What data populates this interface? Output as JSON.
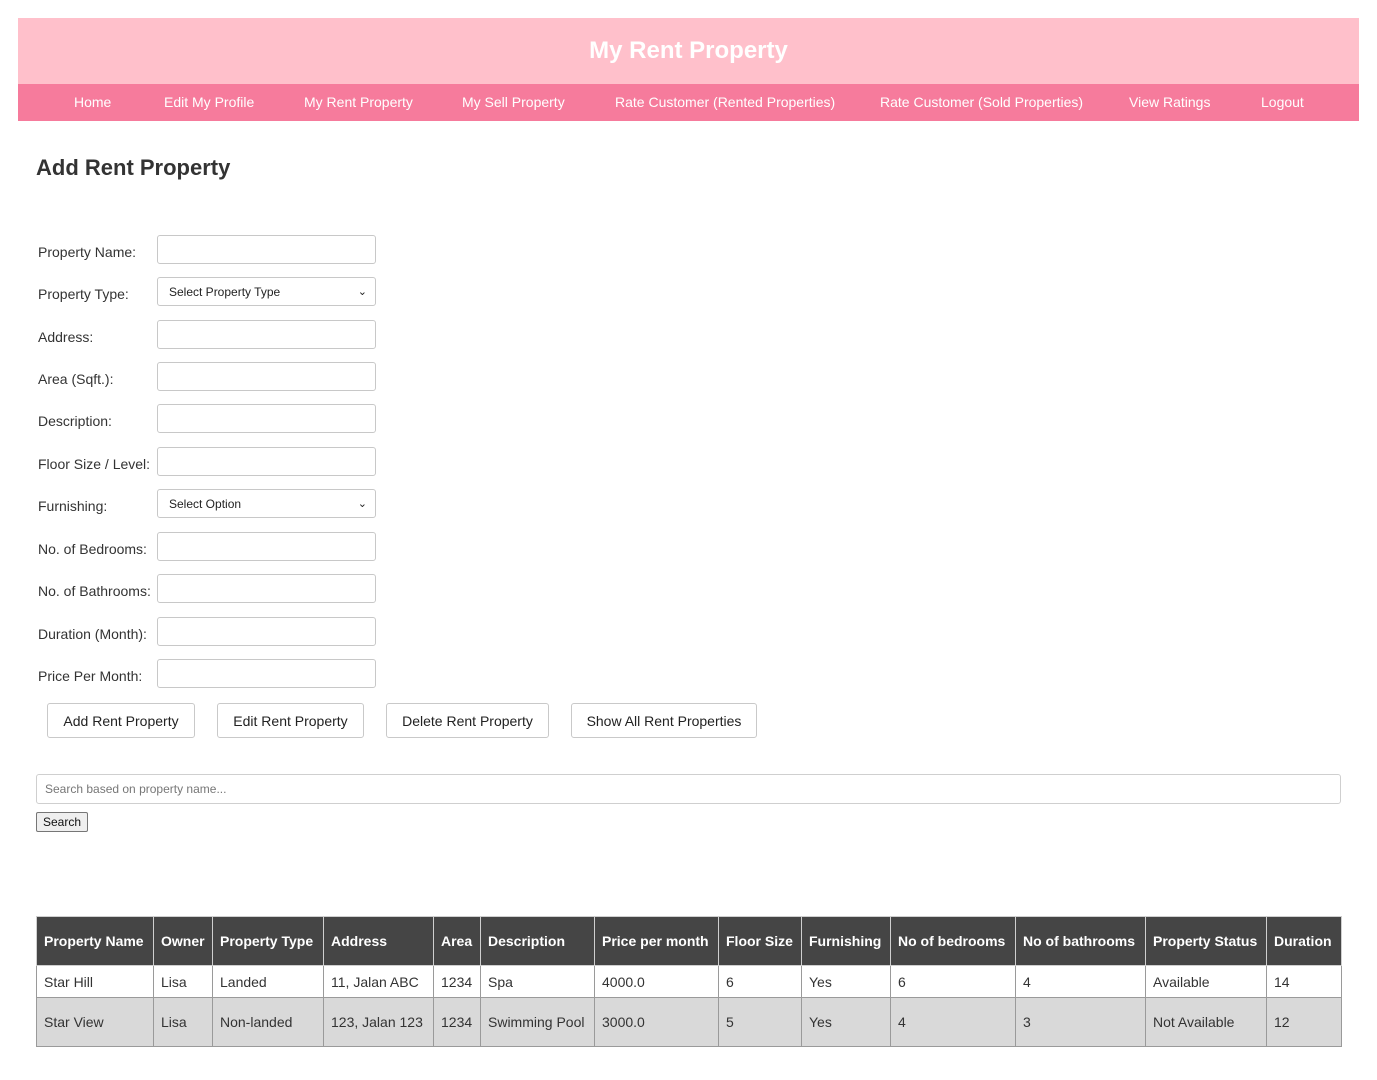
{
  "header": {
    "title": "My Rent Property"
  },
  "nav": [
    "Home",
    "Edit My Profile",
    "My Rent Property",
    "My Sell Property",
    "Rate Customer (Rented Properties)",
    "Rate Customer (Sold Properties)",
    "View Ratings",
    "Logout"
  ],
  "page_title": "Add Rent Property",
  "form": {
    "property_name": "Property Name:",
    "property_type": "Property Type:",
    "property_type_value": "Select Property Type",
    "address": "Address:",
    "area": "Area (Sqft.):",
    "description": "Description:",
    "floor_size": "Floor Size / Level:",
    "furnishing": "Furnishing:",
    "furnishing_value": "Select Option",
    "bedrooms": "No. of Bedrooms:",
    "bathrooms": "No. of Bathrooms:",
    "duration": "Duration (Month):",
    "price": "Price Per Month:"
  },
  "buttons": {
    "add": "Add Rent Property",
    "edit": "Edit Rent Property",
    "delete": "Delete Rent Property",
    "show_all": "Show All Rent Properties"
  },
  "search": {
    "placeholder": "Search based on property name...",
    "button": "Search"
  },
  "table": {
    "headers": [
      "Property Name",
      "Owner",
      "Property Type",
      "Address",
      "Area",
      "Description",
      "Price per month",
      "Floor Size",
      "Furnishing",
      "No of bedrooms",
      "No of bathrooms",
      "Property Status",
      "Duration"
    ],
    "rows": [
      [
        "Star Hill",
        "Lisa",
        "Landed",
        "11, Jalan ABC",
        "1234",
        "Spa",
        "4000.0",
        "6",
        "Yes",
        "6",
        "4",
        "Available",
        "14"
      ],
      [
        "Star View",
        "Lisa",
        "Non-landed",
        "123, Jalan 123",
        "1234",
        "Swimming Pool",
        "3000.0",
        "5",
        "Yes",
        "4",
        "3",
        "Not Available",
        "12"
      ]
    ]
  }
}
